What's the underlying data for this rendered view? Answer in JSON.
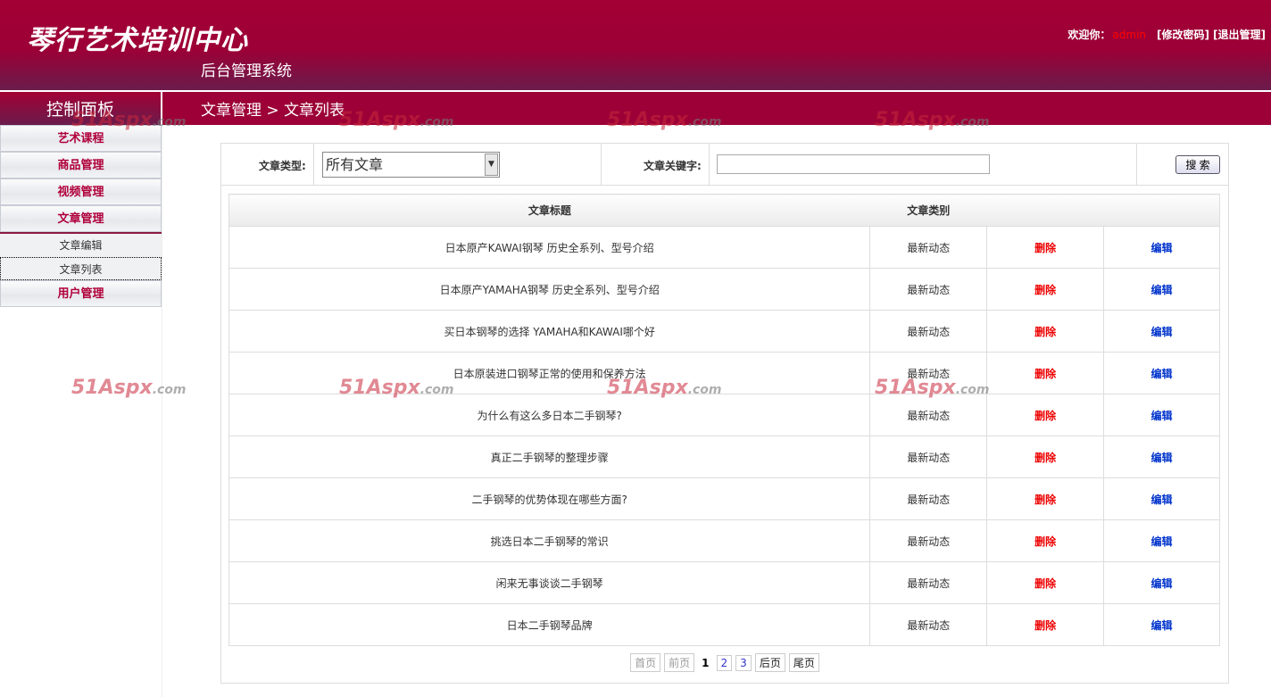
{
  "header": {
    "logo": "琴行艺术培训中心",
    "subtitle": "后台管理系统",
    "welcome": "欢迎你：",
    "user": "admin",
    "change_password": "[修改密码]",
    "logout": "[退出管理]"
  },
  "navbar": {
    "panel_title": "控制面板",
    "breadcrumb": "文章管理 > 文章列表"
  },
  "sidebar": {
    "items": [
      "艺术课程",
      "商品管理",
      "视频管理",
      "文章管理"
    ],
    "subitems": [
      "文章编辑",
      "文章列表"
    ],
    "last": "用户管理"
  },
  "search": {
    "type_label": "文章类型:",
    "type_value": "所有文章",
    "keyword_label": "文章关键字:",
    "keyword_value": "",
    "button": "搜 索"
  },
  "table": {
    "headers": [
      "文章标题",
      "文章类别"
    ],
    "delete": "删除",
    "edit": "编辑",
    "rows": [
      [
        "日本原产KAWAI钢琴 历史全系列、型号介绍",
        "最新动态"
      ],
      [
        "日本原产YAMAHA钢琴 历史全系列、型号介绍",
        "最新动态"
      ],
      [
        "买日本钢琴的选择 YAMAHA和KAWAI哪个好",
        "最新动态"
      ],
      [
        "日本原装进口钢琴正常的使用和保养方法",
        "最新动态"
      ],
      [
        "为什么有这么多日本二手钢琴?",
        "最新动态"
      ],
      [
        "真正二手钢琴的整理步骤",
        "最新动态"
      ],
      [
        "二手钢琴的优势体现在哪些方面?",
        "最新动态"
      ],
      [
        "挑选日本二手钢琴的常识",
        "最新动态"
      ],
      [
        "闲来无事谈谈二手钢琴",
        "最新动态"
      ],
      [
        "日本二手钢琴品牌",
        "最新动态"
      ]
    ]
  },
  "pager": {
    "first": "首页",
    "prev": "前页",
    "pages": [
      "1",
      "2",
      "3"
    ],
    "current": "1",
    "next": "后页",
    "last": "尾页"
  },
  "watermark": {
    "main": "51Aspx",
    ".com": ".com"
  },
  "colors": {
    "brand": "#9c0036",
    "delete": "#ee0000",
    "edit": "#0033cc"
  }
}
